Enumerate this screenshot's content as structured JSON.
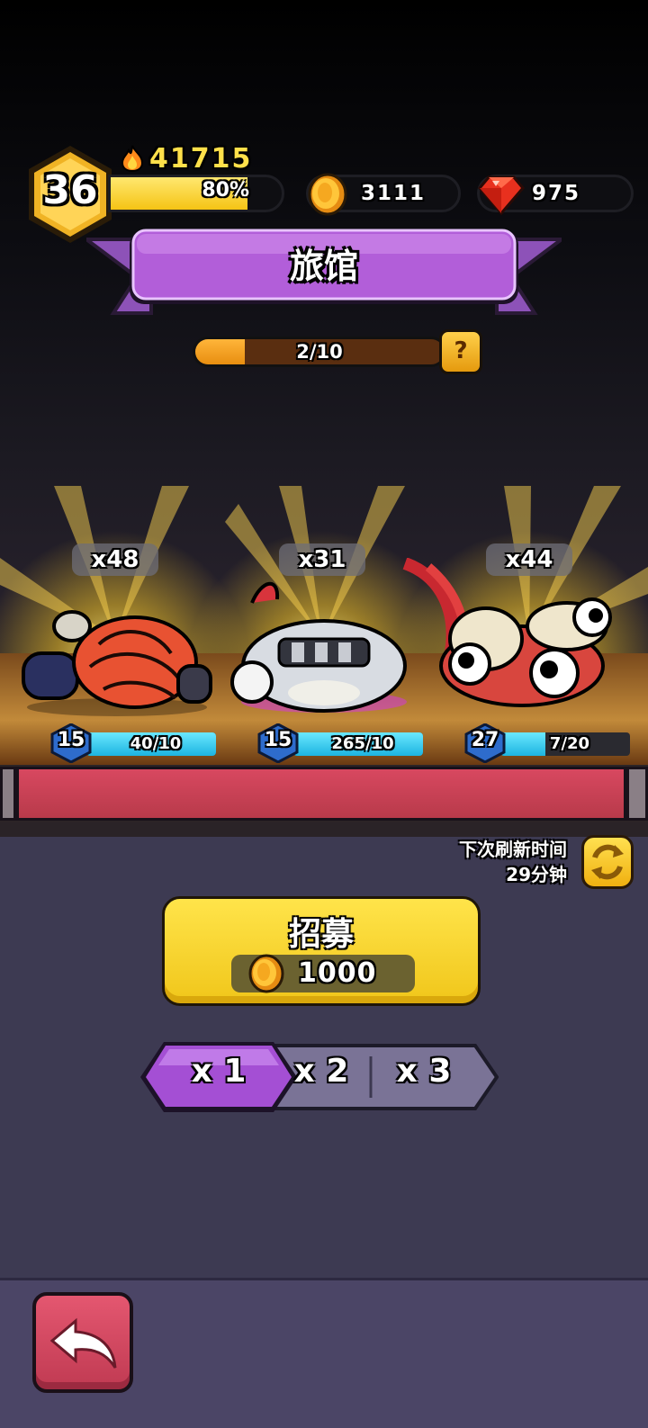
{
  "hud": {
    "level": "36",
    "power": "41715",
    "xp_label": "80%",
    "xp_fraction": 0.8,
    "coins": "3111",
    "gems": "975"
  },
  "title": "旅馆",
  "progress": {
    "label": "2/10",
    "fraction": 0.2
  },
  "heroes": [
    {
      "count": "x48",
      "level": "15",
      "shards": "40/10",
      "shard_fraction": 1.0
    },
    {
      "count": "x31",
      "level": "15",
      "shards": "265/10",
      "shard_fraction": 1.0
    },
    {
      "count": "x44",
      "level": "27",
      "shards": "7/20",
      "shard_fraction": 0.35
    }
  ],
  "refresh": {
    "label": "下次刷新时间",
    "time": "29分钟"
  },
  "recruit": {
    "label": "招募",
    "cost": "1000"
  },
  "multipliers": [
    "x 1",
    "x 2",
    "x 3"
  ],
  "selected_multiplier": 0,
  "colors": {
    "accent_purple": "#a44fd4",
    "gold": "#f5c414",
    "shelf_red": "#c8404f",
    "back_red": "#d94a64"
  },
  "icons": {
    "power": "fire-icon",
    "coin": "coin-icon",
    "gem": "ruby-icon",
    "help": "question-icon",
    "refresh": "refresh-icon",
    "back": "back-arrow-icon"
  }
}
